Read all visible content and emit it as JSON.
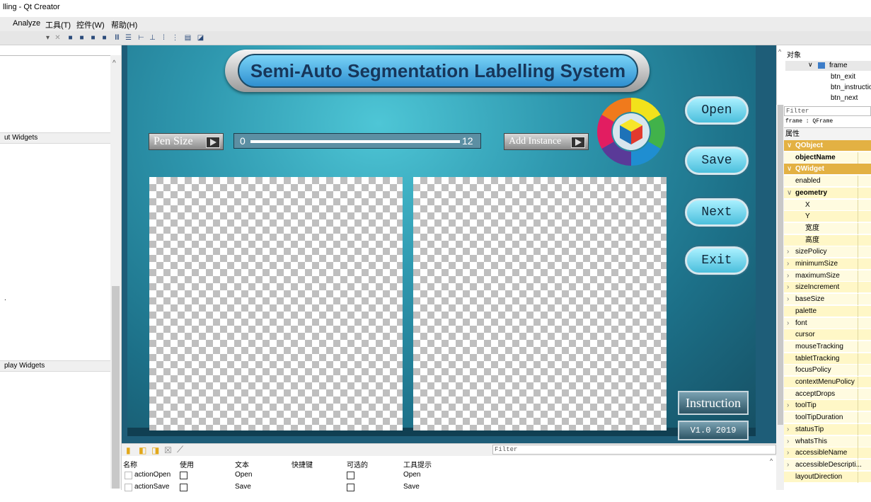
{
  "window": {
    "title": "lling - Qt Creator"
  },
  "menubar": {
    "items": [
      "Analyze",
      "工具(T)",
      "控件(W)",
      "帮助(H)"
    ]
  },
  "left_panel": {
    "categories": [
      "ut Widgets",
      "play Widgets"
    ],
    "stray_dot": "."
  },
  "form": {
    "title": "Semi-Auto Segmentation Labelling System",
    "pen_size_label": "Pen Size",
    "slider_min": "0",
    "slider_max": "12",
    "add_instance_label": "Add Instance",
    "buttons": {
      "open": "Open",
      "save": "Save",
      "next": "Next",
      "exit": "Exit"
    },
    "instruction": "Instruction",
    "version": "V1.0 2019"
  },
  "action_editor": {
    "filter_placeholder": "Filter",
    "headers": [
      "名称",
      "使用",
      "文本",
      "快捷键",
      "可选的",
      "工具提示"
    ],
    "rows": [
      {
        "name": "actionOpen",
        "text": "Open",
        "tooltip": "Open"
      },
      {
        "name": "actionSave",
        "text": "Save",
        "tooltip": "Save"
      }
    ]
  },
  "object_inspector": {
    "header": "对象",
    "root": "frame",
    "children": [
      "btn_exit",
      "btn_instructio",
      "btn_next"
    ]
  },
  "property_editor": {
    "filter_placeholder": "Filter",
    "class_line": "frame : QFrame",
    "header": "属性",
    "rows": [
      {
        "label": "QObject",
        "kind": "group"
      },
      {
        "label": "objectName",
        "kind": "bold"
      },
      {
        "label": "QWidget",
        "kind": "group"
      },
      {
        "label": "enabled",
        "kind": "prop"
      },
      {
        "label": "geometry",
        "kind": "bold-exp"
      },
      {
        "label": "X",
        "kind": "sub"
      },
      {
        "label": "Y",
        "kind": "sub"
      },
      {
        "label": "宽度",
        "kind": "sub"
      },
      {
        "label": "高度",
        "kind": "sub"
      },
      {
        "label": "sizePolicy",
        "kind": "exp"
      },
      {
        "label": "minimumSize",
        "kind": "exp"
      },
      {
        "label": "maximumSize",
        "kind": "exp"
      },
      {
        "label": "sizeIncrement",
        "kind": "exp"
      },
      {
        "label": "baseSize",
        "kind": "exp"
      },
      {
        "label": "palette",
        "kind": "prop"
      },
      {
        "label": "font",
        "kind": "exp"
      },
      {
        "label": "cursor",
        "kind": "prop"
      },
      {
        "label": "mouseTracking",
        "kind": "prop"
      },
      {
        "label": "tabletTracking",
        "kind": "prop"
      },
      {
        "label": "focusPolicy",
        "kind": "prop"
      },
      {
        "label": "contextMenuPolicy",
        "kind": "prop"
      },
      {
        "label": "acceptDrops",
        "kind": "prop"
      },
      {
        "label": "toolTip",
        "kind": "exp"
      },
      {
        "label": "toolTipDuration",
        "kind": "prop"
      },
      {
        "label": "statusTip",
        "kind": "exp"
      },
      {
        "label": "whatsThis",
        "kind": "exp"
      },
      {
        "label": "accessibleName",
        "kind": "exp"
      },
      {
        "label": "accessibleDescripti...",
        "kind": "exp"
      },
      {
        "label": "layoutDirection",
        "kind": "prop"
      }
    ]
  },
  "colors": {
    "accent_group": "#e3b143",
    "prop_bg": "#fff7c7",
    "prop_bg_alt": "#fffbe0",
    "form_bg": "#2e97ae"
  }
}
